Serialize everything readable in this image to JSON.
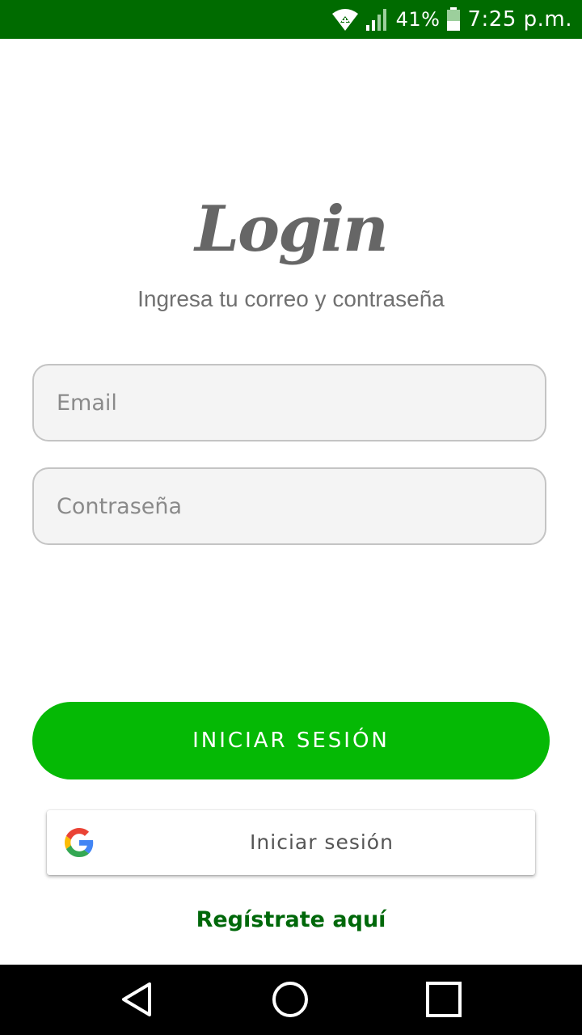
{
  "status_bar": {
    "battery": "41%",
    "time": "7:25 p.m.",
    "background": "#006b00"
  },
  "login": {
    "title": "Login",
    "subtitle": "Ingresa tu correo y contraseña",
    "email_placeholder": "Email",
    "email_value": "",
    "password_placeholder": "Contraseña",
    "password_value": "",
    "submit_label": "INICIAR SESIÓN",
    "google_label": "Iniciar sesión",
    "register_label": "Regístrate aquí"
  },
  "icons": {
    "wifi": "wifi-icon",
    "signal": "signal-icon",
    "battery": "battery-icon",
    "google": "google-logo-icon",
    "back": "back-triangle-icon",
    "home": "home-circle-icon",
    "recent": "recent-square-icon"
  },
  "colors": {
    "primary": "#05b905",
    "link": "#00680a",
    "status_bar": "#006b00"
  }
}
